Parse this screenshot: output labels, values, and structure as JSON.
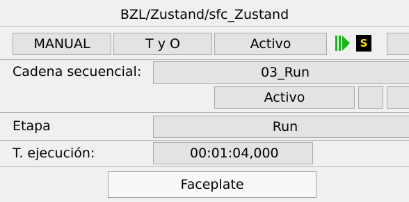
{
  "header": {
    "title": "BZL/Zustand/sfc_Zustand"
  },
  "status_row": {
    "mode": "MANUAL",
    "op": "T y O",
    "state": "Activo",
    "run_icon": "run-icon",
    "s_badge": "S",
    "colors": {
      "run_icon": "#19b419",
      "s_badge_bg": "#000000",
      "s_badge_fg": "#ffe000"
    }
  },
  "sequence": {
    "label": "Cadena secuencial:",
    "value": "03_Run"
  },
  "sequence_status": {
    "state": "Activo"
  },
  "step": {
    "label": "Etapa",
    "value": "Run"
  },
  "exec_time": {
    "label": "T. ejecución:",
    "value": "00:01:04,000"
  },
  "faceplate_button": {
    "label": "Faceplate"
  }
}
